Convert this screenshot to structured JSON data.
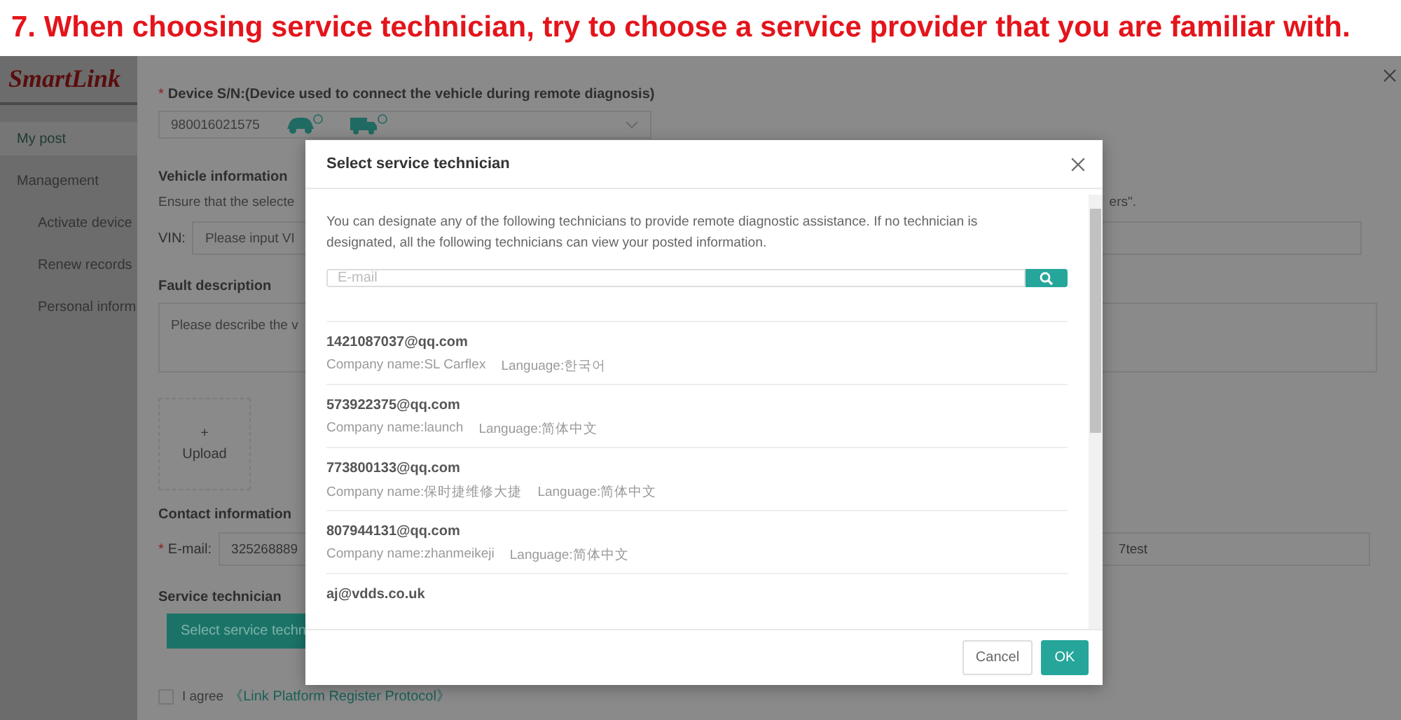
{
  "banner": {
    "text": "7. When choosing service technician, try to choose a service provider that you are familiar with."
  },
  "sidebar": {
    "logo": "SmartLink",
    "items": [
      {
        "label": "My post",
        "selected": true
      },
      {
        "label": "Management",
        "selected": false,
        "children": [
          {
            "label": "Activate device",
            "selected": false
          },
          {
            "label": "Renew records",
            "selected": false
          },
          {
            "label": "Personal inform",
            "selected": false
          }
        ]
      }
    ]
  },
  "form": {
    "required_mark": "*",
    "device_label": "Device S/N:(Device used to connect the vehicle during remote diagnosis)",
    "device_value": "980016021575",
    "vehicle_heading": "Vehicle information",
    "vehicle_note": "Ensure that the selecte",
    "vehicle_note_end": "ers\".",
    "vin_label": "VIN:",
    "vin_placeholder": "Please input VI",
    "fault_heading": "Fault description",
    "fault_placeholder": "Please describe the v",
    "upload_icon": "+",
    "upload_label": "Upload",
    "contact_heading": "Contact information",
    "email_label": "E-mail:",
    "email_value": "325268889",
    "email_value_end": "7test",
    "technician_heading": "Service technician",
    "select_button": "Select service techn",
    "agree_checked": false,
    "agree_label": "I agree",
    "protocol_link": "《Link Platform Register Protocol》"
  },
  "modal": {
    "title": "Select service technician",
    "description": "You can designate any of the following technicians to provide remote diagnostic assistance. If no technician is designated, all the following technicians can view your posted information.",
    "search_placeholder": "E-mail",
    "technicians": [
      {
        "email": "1421087037@qq.com",
        "company": "Company name:SL Carflex",
        "language": "Language:한국어"
      },
      {
        "email": "573922375@qq.com",
        "company": "Company name:launch",
        "language": "Language:简体中文"
      },
      {
        "email": "773800133@qq.com",
        "company": "Company name:保时捷维修大捷",
        "language": "Language:简体中文"
      },
      {
        "email": "807944131@qq.com",
        "company": "Company name:zhanmeikeji",
        "language": "Language:简体中文"
      },
      {
        "email": "aj@vdds.co.uk"
      }
    ],
    "cancel": "Cancel",
    "ok": "OK"
  }
}
